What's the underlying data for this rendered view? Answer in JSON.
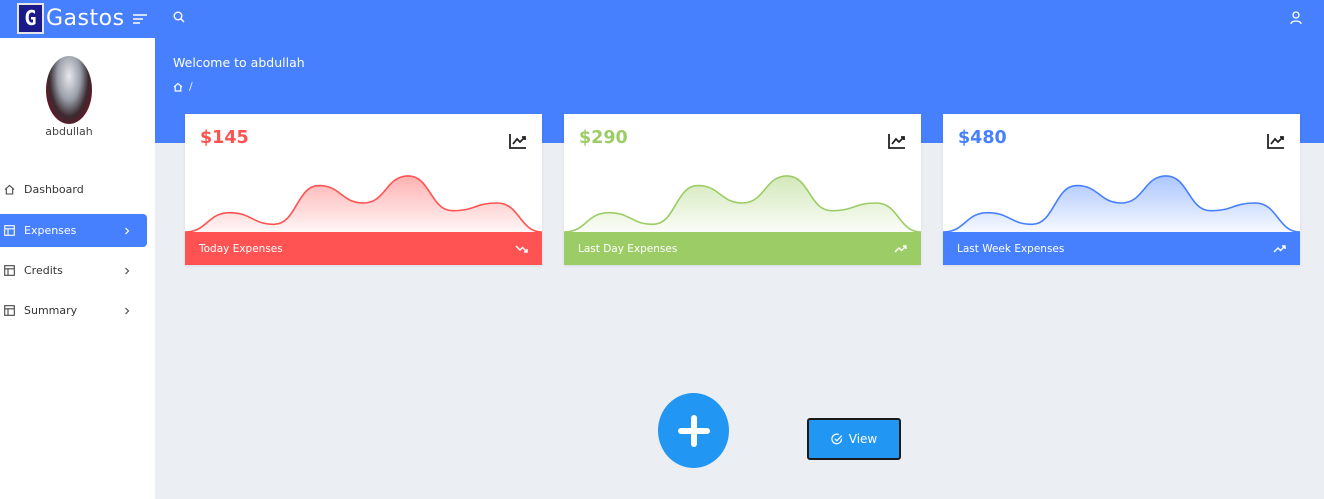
{
  "app": {
    "logo_letter": "G",
    "name": "Gastos"
  },
  "header": {
    "welcome": "Welcome to abdullah",
    "breadcrumb_sep": "/"
  },
  "user": {
    "name": "abdullah"
  },
  "sidebar": {
    "items": [
      {
        "label": "Dashboard",
        "icon": "home-icon",
        "active": false,
        "has_chevron": false
      },
      {
        "label": "Expenses",
        "icon": "layout-icon",
        "active": true,
        "has_chevron": true
      },
      {
        "label": "Credits",
        "icon": "layout-icon",
        "active": false,
        "has_chevron": true
      },
      {
        "label": "Summary",
        "icon": "layout-icon",
        "active": false,
        "has_chevron": true
      }
    ]
  },
  "cards": [
    {
      "amount": "$145",
      "label": "Today Expenses",
      "color": "#ff5252",
      "footer_icon": "trending-down-icon",
      "series": [
        0,
        20,
        8,
        48,
        30,
        58,
        22,
        30,
        0
      ]
    },
    {
      "amount": "$290",
      "label": "Last Day Expenses",
      "color": "#9ccc65",
      "footer_icon": "trending-up-icon",
      "series": [
        0,
        20,
        8,
        48,
        30,
        58,
        22,
        30,
        0
      ]
    },
    {
      "amount": "$480",
      "label": "Last Week Expenses",
      "color": "#4680ff",
      "footer_icon": "trending-up-icon",
      "series": [
        0,
        20,
        8,
        48,
        30,
        58,
        22,
        30,
        0
      ]
    }
  ],
  "actions": {
    "add_icon": "plus-icon",
    "view_label": "View"
  },
  "colors": {
    "primary": "#4680ff",
    "action": "#2196f3",
    "background": "#ebeef3"
  }
}
